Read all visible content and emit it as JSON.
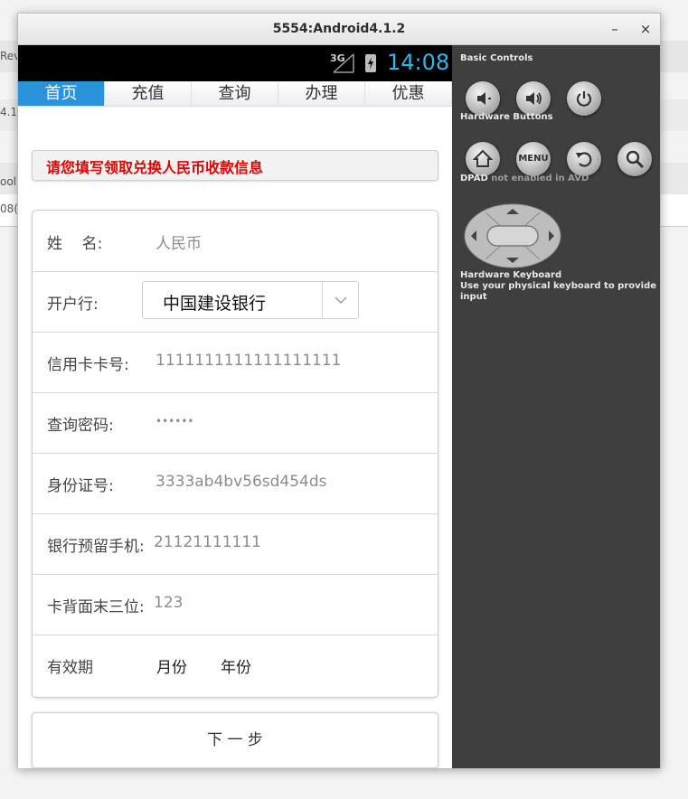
{
  "background": {
    "fragments": [
      "Rev",
      "4.1",
      "ool",
      "08("
    ]
  },
  "window": {
    "title": "5554:Android4.1.2",
    "minimize_label": "–",
    "close_label": "×"
  },
  "statusbar": {
    "signal": "3G",
    "time": "14:08",
    "time_color": "#33b5e5"
  },
  "tabs": [
    {
      "label": "首页",
      "active": true
    },
    {
      "label": "充值",
      "active": false
    },
    {
      "label": "查询",
      "active": false
    },
    {
      "label": "办理",
      "active": false
    },
    {
      "label": "优惠",
      "active": false
    }
  ],
  "notice": {
    "text": "请您填写领取兑换人民币收款信息",
    "color": "#e00000"
  },
  "form": {
    "name": {
      "label": "姓    名:",
      "value": "人民币"
    },
    "bank": {
      "label": "开户行:",
      "selected": "中国建设银行"
    },
    "card": {
      "label": "信用卡卡号:",
      "value": "1111111111111111111"
    },
    "password": {
      "label": "查询密码:",
      "value": "••••••"
    },
    "id": {
      "label": "身份证号:",
      "value": "3333ab4bv56sd454ds"
    },
    "phone": {
      "label": "银行预留手机:",
      "value": "21121111111"
    },
    "cvv": {
      "label": "卡背面末三位:",
      "value": "123"
    },
    "expiry": {
      "label": "有效期",
      "month": "月份",
      "year": "年份"
    }
  },
  "next_button": {
    "label": "下 一 步"
  },
  "panel": {
    "basic_controls": "Basic Controls",
    "hardware_buttons": "Hardware Buttons",
    "menu_label": "MENU",
    "dpad_label": "DPAD",
    "dpad_note": "not enabled in AVD",
    "keyboard_title": "Hardware Keyboard",
    "keyboard_hint": "Use your physical keyboard to provide input"
  }
}
